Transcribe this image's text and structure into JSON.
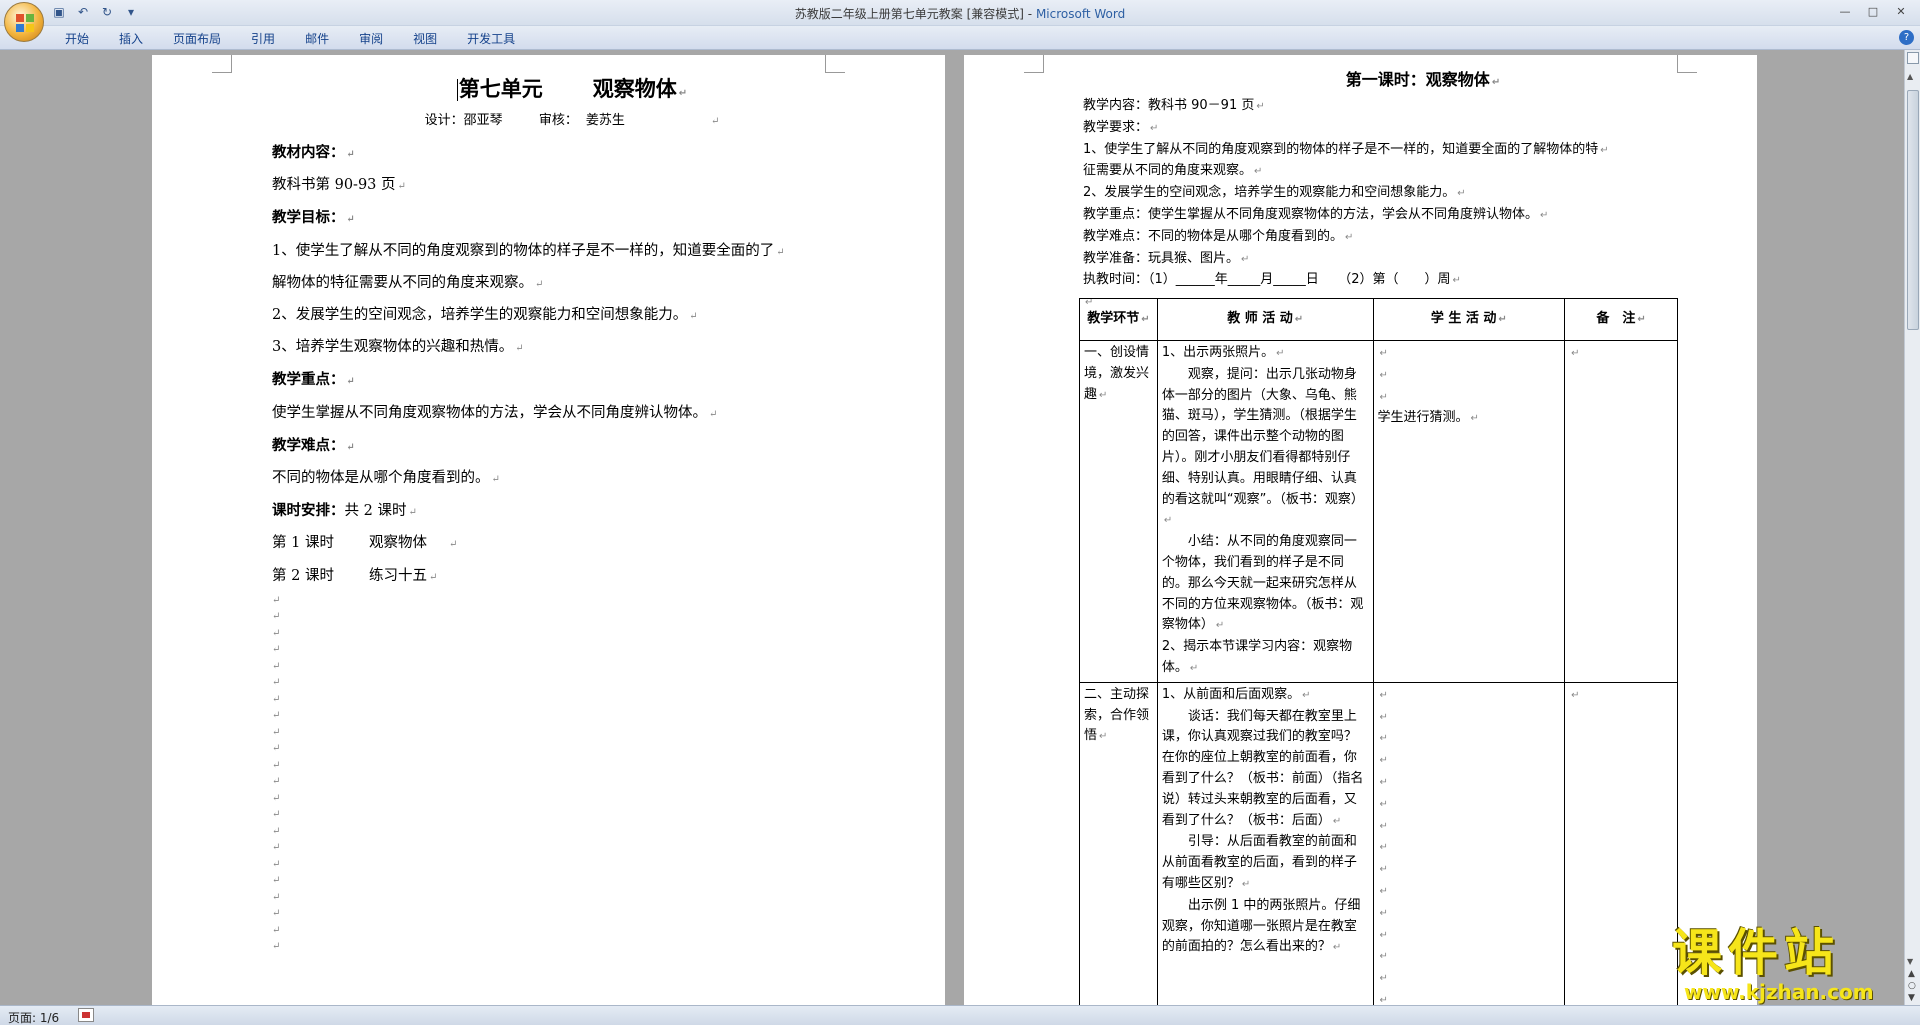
{
  "window": {
    "title": "苏教版二年级上册第七单元教案 [兼容模式]",
    "app_name": "Microsoft Word",
    "title_separator": " - "
  },
  "ribbon": {
    "tabs": [
      "开始",
      "插入",
      "页面布局",
      "引用",
      "邮件",
      "审阅",
      "视图",
      "开发工具"
    ]
  },
  "page1": {
    "title_a": "第七单元",
    "title_b": "观察物体",
    "designer_label": "设计：",
    "designer": "邵亚琴",
    "reviewer_label": "审核：",
    "reviewer": "姜苏生",
    "lines": [
      {
        "text": "教材内容：",
        "bold": true
      },
      {
        "text": "教科书第 90-93 页",
        "bold": false
      },
      {
        "text": "教学目标：",
        "bold": true
      },
      {
        "text": "1、使学生了解从不同的角度观察到的物体的样子是不一样的，知道要全面的了",
        "bold": false
      },
      {
        "text": "解物体的特征需要从不同的角度来观察。",
        "bold": false
      },
      {
        "text": "2、发展学生的空间观念，培养学生的观察能力和空间想象能力。",
        "bold": false
      },
      {
        "text": "3、培养学生观察物体的兴趣和热情。",
        "bold": false
      },
      {
        "text": "教学重点：",
        "bold": true
      },
      {
        "text": "使学生掌握从不同角度观察物体的方法，学会从不同角度辨认物体。",
        "bold": false
      },
      {
        "text": "教学难点：",
        "bold": true
      },
      {
        "text": "不同的物体是从哪个角度看到的。",
        "bold": false
      }
    ],
    "schedule_label": "课时安排：",
    "schedule_value": "共 2 课时",
    "lessons": [
      {
        "no": "第 1 课时",
        "name": "观察物体"
      },
      {
        "no": "第 2 课时",
        "name": "练习十五"
      }
    ],
    "empty_line_count": 22
  },
  "page2": {
    "title": "第一课时：观察物体",
    "lines": [
      "教学内容：教科书 90－91 页",
      "教学要求：",
      "1、使学生了解从不同的角度观察到的物体的样子是不一样的，知道要全面的了解物体的特",
      "征需要从不同的角度来观察。",
      "2、发展学生的空间观念，培养学生的观察能力和空间想象能力。",
      "教学重点：使学生掌握从不同角度观察物体的方法，学会从不同角度辨认物体。",
      "教学难点：不同的物体是从哪个角度看到的。",
      "教学准备：玩具猴、图片。",
      "执教时间：（1）______年_____月_____日　　（2）第（　　）周"
    ],
    "table": {
      "headers": [
        "教学环节",
        "教 师 活 动",
        "学 生 活 动",
        "备　注"
      ],
      "rows": [
        {
          "stage": "一、创设情境，激发兴趣",
          "teacher": [
            {
              "text": "1、出示两张照片。",
              "indent": false
            },
            {
              "text": "观察，提问：出示几张动物身体一部分的图片（大象、乌龟、熊猫、斑马），学生猜测。（根据学生的回答，课件出示整个动物的图片）。刚才小朋友们看得都特别仔细、特别认真。用眼睛仔细、认真的看这就叫“观察”。（板书：观察）",
              "indent": true
            },
            {
              "text": "小结：从不同的角度观察同一个物体，我们看到的样子是不同的。那么今天就一起来研究怎样从不同的方位来观察物体。（板书：观察物体）",
              "indent": true
            },
            {
              "text": "2、揭示本节课学习内容：观察物体。",
              "indent": false
            }
          ],
          "student": "学生进行猜测。",
          "student_blank_before": 3,
          "note": ""
        },
        {
          "stage": "二、主动探索，合作领悟",
          "teacher": [
            {
              "text": "1、从前面和后面观察。",
              "indent": false
            },
            {
              "text": "谈话：我们每天都在教室里上课，你认真观察过我们的教室吗？在你的座位上朝教室的前面看，你看到了什么？（板书：前面）（指名说）转过头来朝教室的后面看，又看到了什么？（板书：后面）",
              "indent": true
            },
            {
              "text": "引导：从后面看教室的前面和从前面看教室的后面，看到的样子有哪些区别？",
              "indent": true
            },
            {
              "text": "出示例 1 中的两张照片。仔细观察，你知道哪一张照片是在教室的前面拍的？怎么看出来的？",
              "indent": true
            }
          ],
          "student": "",
          "student_blank_before": 15,
          "note": ""
        }
      ]
    }
  },
  "status": {
    "page_info": "页面: 1/6"
  },
  "watermark": {
    "main": "课件站",
    "url": "www.kjzhan.com"
  },
  "colors": {
    "workspace": "#a7a7a7",
    "ribbon_text": "#15428b",
    "watermark": "#f6e51a"
  }
}
